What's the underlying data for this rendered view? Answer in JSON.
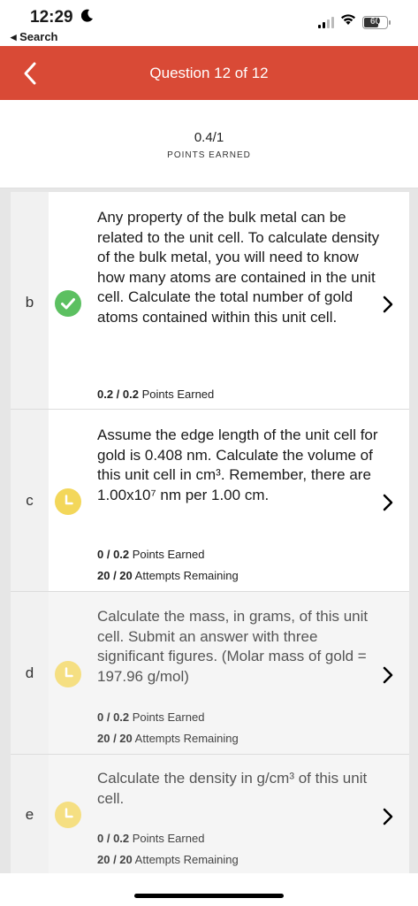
{
  "status_bar": {
    "time": "12:29",
    "back_label": "◂ Search",
    "battery": "60"
  },
  "header": {
    "title": "Question 12 of 12",
    "accent_color": "#d94a36"
  },
  "summary": {
    "score": "0.4/1",
    "score_label": "POINTS EARNED"
  },
  "parts": [
    {
      "letter": "b",
      "status": "complete",
      "question": "Any property of the bulk metal can be related to the unit cell. To calculate density of the bulk metal, you will need to know how many atoms are contained in the unit cell. Calculate the total number of gold atoms contained within this unit cell.",
      "points_value": "0.2 / 0.2",
      "points_suffix": "Points Earned"
    },
    {
      "letter": "c",
      "status": "in-progress",
      "question": "Assume the edge length of the unit cell for gold is 0.408 nm. Calculate the volume of this unit cell in cm³. Remember, there are 1.00x10⁷ nm per 1.00 cm.",
      "points_value": "0 / 0.2",
      "points_suffix": "Points Earned",
      "attempts_value": "20 / 20",
      "attempts_suffix": "Attempts Remaining"
    },
    {
      "letter": "d",
      "status": "in-progress",
      "question": "Calculate the mass, in grams, of this unit cell. Submit an answer with three significant figures. (Molar mass of gold = 197.96 g/mol)",
      "points_value": "0 / 0.2",
      "points_suffix": "Points Earned",
      "attempts_value": "20 / 20",
      "attempts_suffix": "Attempts Remaining"
    },
    {
      "letter": "e",
      "status": "in-progress",
      "question": "Calculate the density in g/cm³ of this unit cell.",
      "points_value": "0 / 0.2",
      "points_suffix": "Points Earned",
      "attempts_value": "20 / 20",
      "attempts_suffix": "Attempts Remaining"
    }
  ]
}
